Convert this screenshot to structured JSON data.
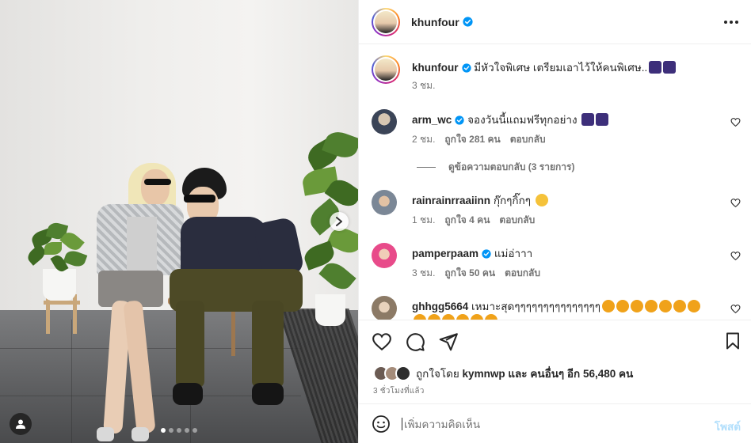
{
  "post": {
    "author": "khunfour",
    "verified_color": "#0095f6",
    "more_icon": "more-horizontal-icon"
  },
  "caption": {
    "username": "khunfour",
    "text": "มีหัวใจพิเศษ เตรียมเอาไว้ให้คนพิเศษ..",
    "emojis": [
      "music-notes-emoji",
      "music-notes-emoji"
    ],
    "time": "3 ชม."
  },
  "comments": [
    {
      "username": "arm_wc",
      "verified": true,
      "text": "จองวันนี้แถมฟรีทุกอย่าง",
      "emojis": [
        "music-notes-emoji",
        "music-notes-emoji"
      ],
      "time": "2 ชม.",
      "likes": "ถูกใจ 281 คน",
      "reply": "ตอบกลับ"
    },
    {
      "username": "rainrainrraaiinn",
      "verified": false,
      "text": "กุ๊กๆกิ๊กๆ",
      "emojis": [
        "smiling-face-emoji"
      ],
      "time": "1 ชม.",
      "likes": "ถูกใจ 4 คน",
      "reply": "ตอบกลับ"
    },
    {
      "username": "pamperpaam",
      "verified": true,
      "text": "แม่อ่าาา",
      "emojis": [],
      "time": "3 ชม.",
      "likes": "ถูกใจ 50 คน",
      "reply": "ตอบกลับ"
    },
    {
      "username": "ghhgg5664",
      "verified": false,
      "text": "เหมาะสุดๆๆๆๆๆๆๆๆๆๆๆๆๆๆๆ",
      "emojis": [
        "star-struck-emoji"
      ]
    }
  ],
  "view_replies": "ดูข้อความตอบกลับ (3 รายการ)",
  "likes_summary": {
    "prefix": "ถูกใจโดย",
    "user": "kymnwp",
    "middle": "และ",
    "others": "คนอื่นๆ อีก 56,480 คน"
  },
  "post_time": "3 ชั่วโมงที่แล้ว",
  "add_comment": {
    "placeholder": "เพิ่มความคิดเห็น",
    "post_label": "โพสต์",
    "post_color": "#b2dffc"
  },
  "carousel": {
    "total": 5,
    "current": 1
  },
  "colors": {
    "border": "#efefef",
    "secondary_text": "#737373",
    "primary_text": "#262626"
  }
}
